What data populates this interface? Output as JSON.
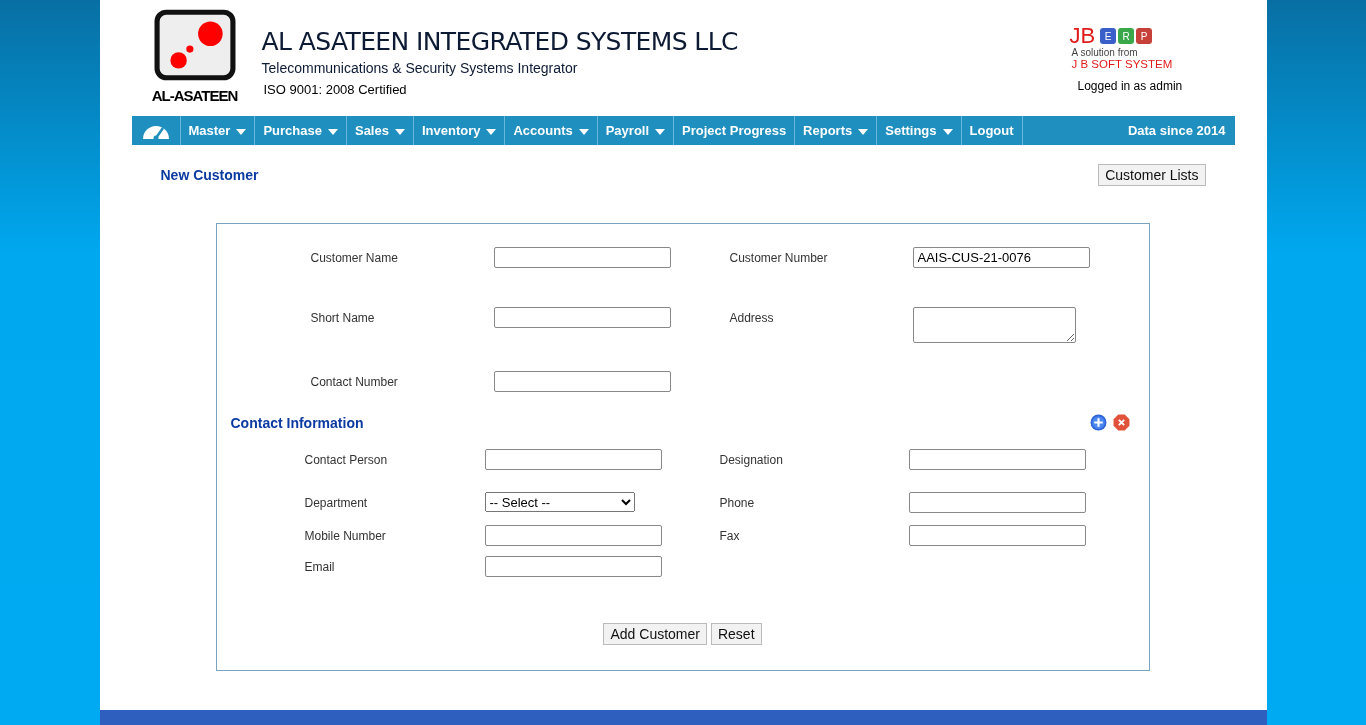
{
  "header": {
    "logo_caption": "AL-ASATEEN",
    "company": "AL ASATEEN INTEGRATED SYSTEMS LLC",
    "tagline": "Telecommunications & Security Systems Integrator",
    "certification": "ISO 9001: 2008 Certified",
    "erp_brand": "JB",
    "erp_tiles": [
      {
        "letter": "E",
        "color": "#3a5fc8"
      },
      {
        "letter": "R",
        "color": "#3aa84a"
      },
      {
        "letter": "P",
        "color": "#c8403a"
      }
    ],
    "erp_subtitle": "A solution from",
    "erp_vendor": "J B SOFT SYSTEM",
    "login_status": "Logged in as admin"
  },
  "nav": {
    "items": [
      {
        "label": "Master",
        "dropdown": true
      },
      {
        "label": "Purchase",
        "dropdown": true
      },
      {
        "label": "Sales",
        "dropdown": true
      },
      {
        "label": "Inventory",
        "dropdown": true
      },
      {
        "label": "Accounts",
        "dropdown": true
      },
      {
        "label": "Payroll",
        "dropdown": true
      },
      {
        "label": "Project Progress",
        "dropdown": false
      },
      {
        "label": "Reports",
        "dropdown": true
      },
      {
        "label": "Settings",
        "dropdown": true
      },
      {
        "label": "Logout",
        "dropdown": false
      }
    ],
    "note": "Data since 2014"
  },
  "page_title": "New Customer",
  "list_button": "Customer Lists",
  "customer_fields": [
    {
      "label": "Customer Name",
      "kind": "text"
    },
    {
      "label": "Customer Number",
      "kind": "text",
      "value": "AAIS-CUS-21-0076"
    },
    {
      "label": "Short Name",
      "kind": "text"
    },
    {
      "label": "Address",
      "kind": "textarea"
    },
    {
      "label": "Contact Number",
      "kind": "text"
    }
  ],
  "contact_section": {
    "title": "Contact Information"
  },
  "contact_fields": [
    {
      "label": "Contact Person",
      "kind": "text"
    },
    {
      "label": "Designation",
      "kind": "text"
    },
    {
      "label": "Department",
      "kind": "select",
      "value": "-- Select --"
    },
    {
      "label": "Phone",
      "kind": "text"
    },
    {
      "label": "Mobile Number",
      "kind": "text"
    },
    {
      "label": "Fax",
      "kind": "text"
    },
    {
      "label": "Email",
      "kind": "text"
    }
  ],
  "buttons": [
    "Add Customer",
    "Reset"
  ]
}
